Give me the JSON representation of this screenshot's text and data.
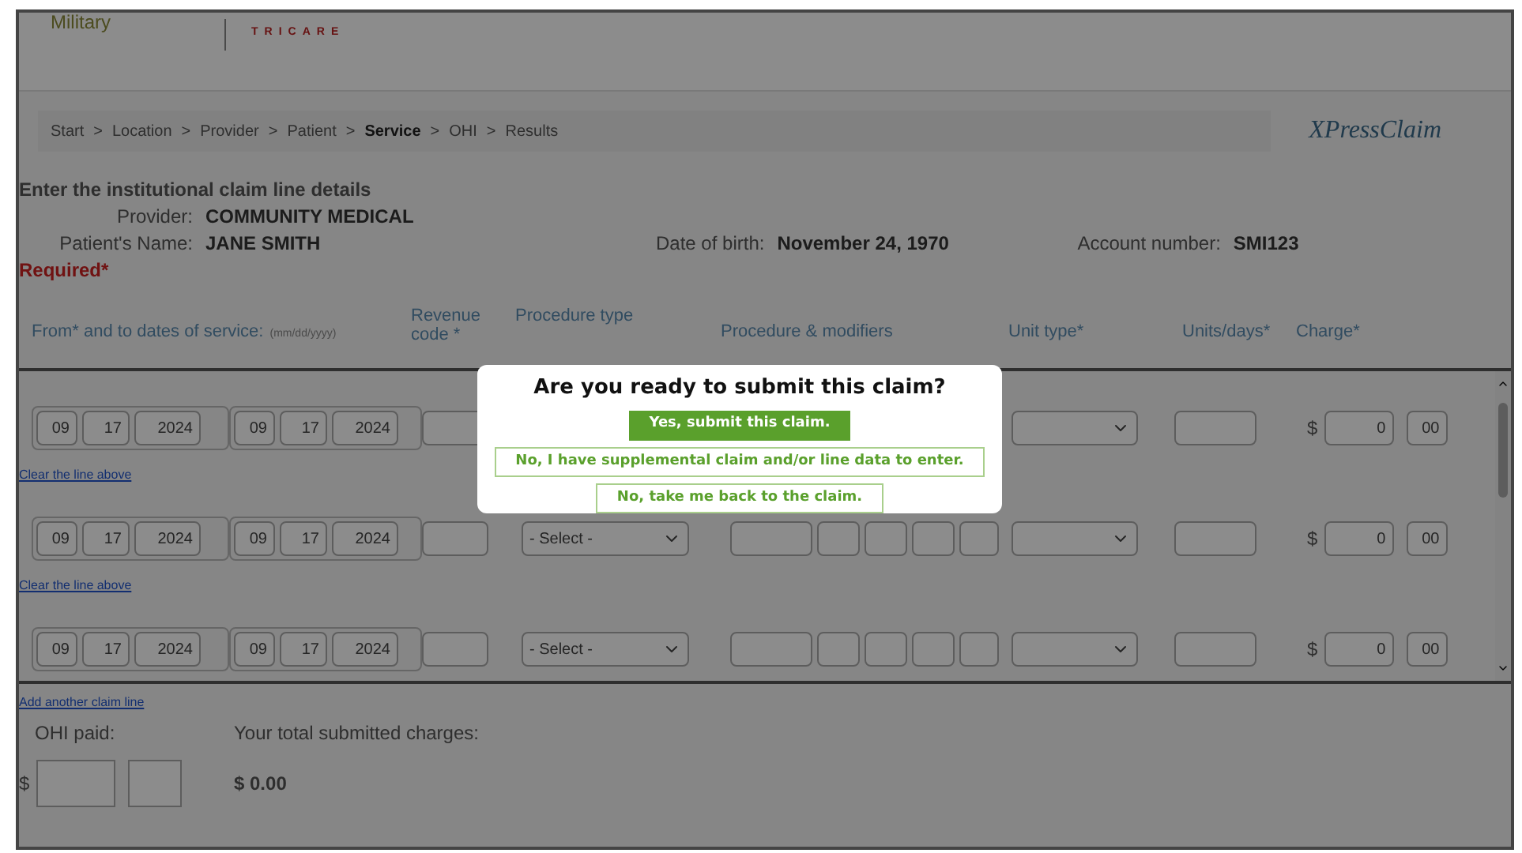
{
  "header": {
    "left_text": "Military",
    "logo_text": "TRICARE"
  },
  "breadcrumb": [
    {
      "label": "Start",
      "selected": false
    },
    {
      "label": "Location",
      "selected": false
    },
    {
      "label": "Provider",
      "selected": false
    },
    {
      "label": "Patient",
      "selected": false
    },
    {
      "label": "Service",
      "selected": true
    },
    {
      "label": "OHI",
      "selected": false
    },
    {
      "label": "Results",
      "selected": false
    }
  ],
  "breadcrumb_separator": ">",
  "brand_logo": "XPressClaim",
  "heading": "Enter the institutional claim line details",
  "provider": {
    "label": "Provider:",
    "value": "COMMUNITY MEDICAL"
  },
  "patient": {
    "label": "Patient's Name:",
    "value": "JANE SMITH"
  },
  "date_of_birth": {
    "label": "Date of birth:",
    "value": "November 24, 1970"
  },
  "account_number": {
    "label": "Account number:",
    "value": "SMI123"
  },
  "required_note": "Required*",
  "columns": {
    "dates": "From* and to dates of service:",
    "date_format": "(mm/dd/yyyy)",
    "revenue_code": "Revenue code *",
    "procedure_type": "Procedure type",
    "procedure_modifiers": "Procedure & modifiers",
    "unit_type": "Unit type*",
    "units_days": "Units/days*",
    "charge": "Charge*"
  },
  "rows": [
    {
      "from": [
        "09",
        "17",
        "2024"
      ],
      "to": [
        "09",
        "17",
        "2024"
      ],
      "currency": "$",
      "charge": "0",
      "cents": "00",
      "clear_link": "Clear the line above"
    },
    {
      "from": [
        "09",
        "17",
        "2024"
      ],
      "to": [
        "09",
        "17",
        "2024"
      ],
      "procedure_type": "- Select -",
      "currency": "$",
      "charge": "0",
      "cents": "00",
      "clear_link": "Clear the line above"
    },
    {
      "from": [
        "09",
        "17",
        "2024"
      ],
      "to": [
        "09",
        "17",
        "2024"
      ],
      "procedure_type": "- Select -",
      "currency": "$",
      "charge": "0",
      "cents": "00"
    }
  ],
  "add_line_link": "Add another claim line",
  "ohi_paid": {
    "label": "OHI paid:",
    "currency": "$"
  },
  "total": {
    "label": "Your total submitted charges:",
    "value": "$ 0.00"
  },
  "dialog": {
    "title": "Are you ready to submit this claim?",
    "buttons": [
      {
        "label": "Yes, submit this claim.",
        "kind": "primary"
      },
      {
        "label": "No, I have supplemental claim and/or line data to enter.",
        "kind": "outline"
      },
      {
        "label": "No, take me back to the claim.",
        "kind": "outline"
      }
    ]
  }
}
